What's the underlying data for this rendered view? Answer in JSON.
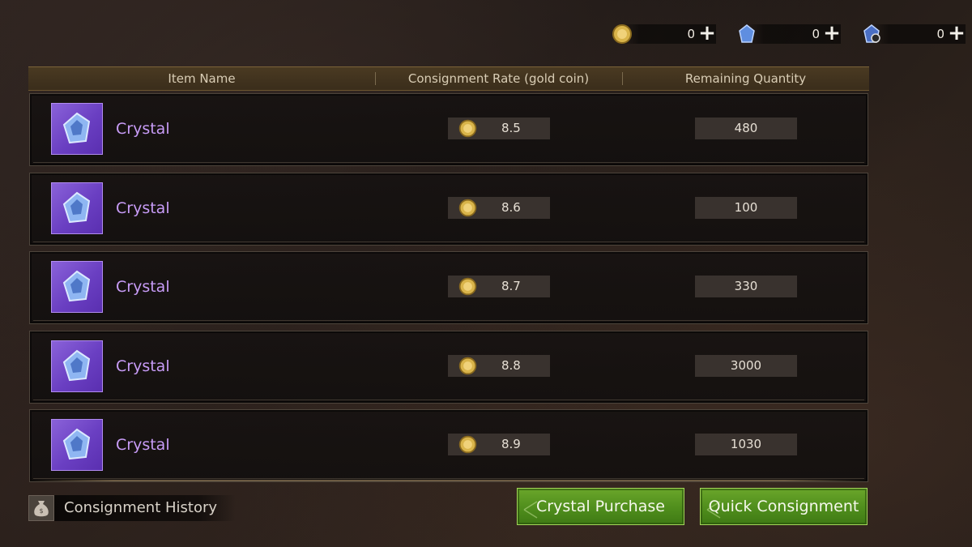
{
  "currencies": [
    {
      "icon": "gold-coin-icon",
      "value": "0"
    },
    {
      "icon": "crystal-icon",
      "value": "0"
    },
    {
      "icon": "bound-crystal-icon",
      "value": "0"
    }
  ],
  "table": {
    "headers": [
      "Item Name",
      "Consignment Rate (gold coin)",
      "Remaining Quantity"
    ],
    "rows": [
      {
        "name": "Crystal",
        "rate": "8.5",
        "quantity": "480"
      },
      {
        "name": "Crystal",
        "rate": "8.6",
        "quantity": "100"
      },
      {
        "name": "Crystal",
        "rate": "8.7",
        "quantity": "330"
      },
      {
        "name": "Crystal",
        "rate": "8.8",
        "quantity": "3000"
      },
      {
        "name": "Crystal",
        "rate": "8.9",
        "quantity": "1030"
      }
    ]
  },
  "footer": {
    "history_label": "Consignment History",
    "purchase_label": "Crystal Purchase",
    "consign_label": "Quick Consignment"
  },
  "colors": {
    "item_name": "#c89cf7",
    "button_green": "#4f8d1c",
    "header_gold": "#4a3a22"
  }
}
